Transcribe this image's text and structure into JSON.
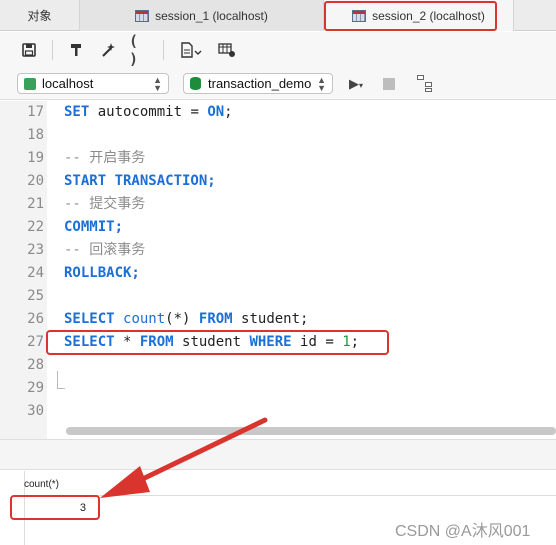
{
  "tabs": [
    {
      "label": "对象"
    },
    {
      "label": "session_1 (localhost)"
    },
    {
      "label": "session_2 (localhost)"
    }
  ],
  "toolbar": {
    "icons": [
      "save-icon",
      "format-icon",
      "beautify-icon",
      "parentheses-icon",
      "code-snippet-icon",
      "query-builder-icon"
    ]
  },
  "connection": {
    "value": "localhost"
  },
  "database": {
    "value": "transaction_demo"
  },
  "editor": {
    "lines": [
      {
        "number": "17",
        "text": "SET autocommit = ON;"
      },
      {
        "number": "18",
        "text": ""
      },
      {
        "number": "19",
        "text": "-- 开启事务"
      },
      {
        "number": "20",
        "text": "START TRANSACTION;"
      },
      {
        "number": "21",
        "text": "-- 提交事务"
      },
      {
        "number": "22",
        "text": "COMMIT;"
      },
      {
        "number": "23",
        "text": "-- 回滚事务"
      },
      {
        "number": "24",
        "text": "ROLLBACK;"
      },
      {
        "number": "25",
        "text": ""
      },
      {
        "number": "26",
        "text": "SELECT count(*) FROM student;"
      },
      {
        "number": "27",
        "text": "SELECT * FROM student WHERE id = 1;"
      },
      {
        "number": "28",
        "text": ""
      },
      {
        "number": "29",
        "text": ""
      },
      {
        "number": "30",
        "text": ""
      }
    ]
  },
  "result": {
    "column": "count(*)",
    "value": "3"
  },
  "watermark": "CSDN @A沐风001",
  "colors": {
    "highlight": "#d9352e",
    "keyword": "#1b6fd6",
    "number": "#1a9b3a"
  }
}
